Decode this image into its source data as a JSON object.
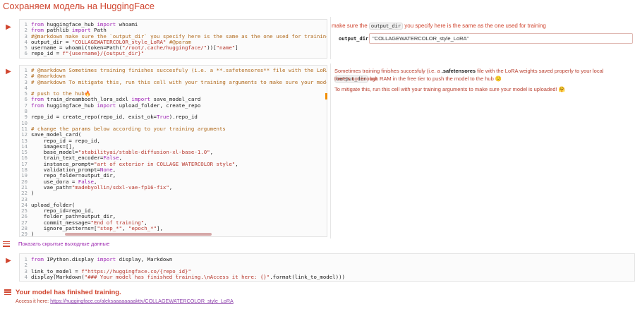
{
  "section": {
    "title": "Сохраняем модель на HuggingFace"
  },
  "cell1": {
    "lines": [
      {
        "n": "1",
        "t": "from huggingface_hub import whoami"
      },
      {
        "n": "2",
        "t": "from pathlib import Path"
      },
      {
        "n": "3",
        "t": "#@markdown make sure the `output_dir` you specify here is the same as the one used for training"
      },
      {
        "n": "4",
        "t": "output_dir = \"COLLAGEWATERCOLOR_style_LoRA\" #@param"
      },
      {
        "n": "5",
        "t": "username = whoami(token=Path(\"/root/.cache/huggingface/\"))[\"name\"]"
      },
      {
        "n": "6",
        "t": "repo_id = f\"{username}/{output_dir}\""
      }
    ],
    "form": {
      "note_pre": "make sure the ",
      "note_code": "output_dir",
      "note_post": " you specify here is the same as the one used for training",
      "field_label": "output_dir:",
      "field_value": "\"COLLAGEWATERCOLOR_style_LoRA\""
    }
  },
  "cell2": {
    "lines": [
      {
        "n": "1",
        "t": "# @markdown Sometimes training finishes succesfuly (i.e. a **.safetensores** file with the LoRA weights saved properly to your l"
      },
      {
        "n": "2",
        "t": "# @markdown"
      },
      {
        "n": "3",
        "t": "# @markdown To mitigate this, run this cell with your training arguments to make sure your model is uploaded! 🤗"
      },
      {
        "n": "4",
        "t": ""
      },
      {
        "n": "5",
        "t": "# push to the hub🔥"
      },
      {
        "n": "6",
        "t": "from train_dreambooth_lora_sdxl import save_model_card"
      },
      {
        "n": "7",
        "t": "from huggingface_hub import upload_folder, create_repo"
      },
      {
        "n": "8",
        "t": ""
      },
      {
        "n": "9",
        "t": "repo_id = create_repo(repo_id, exist_ok=True).repo_id"
      },
      {
        "n": "10",
        "t": ""
      },
      {
        "n": "11",
        "t": "# change the params below according to your training arguments"
      },
      {
        "n": "12",
        "t": "save_model_card("
      },
      {
        "n": "13",
        "t": "    repo_id = repo_id,"
      },
      {
        "n": "14",
        "t": "    images=[],"
      },
      {
        "n": "15",
        "t": "    base_model=\"stabilityai/stable-diffusion-xl-base-1.0\","
      },
      {
        "n": "16",
        "t": "    train_text_encoder=False,"
      },
      {
        "n": "17",
        "t": "    instance_prompt=\"art of exterior in COLLAGE WATERCOLOR style\","
      },
      {
        "n": "18",
        "t": "    validation_prompt=None,"
      },
      {
        "n": "19",
        "t": "    repo_folder=output_dir,"
      },
      {
        "n": "20",
        "t": "    use_dora = False,"
      },
      {
        "n": "21",
        "t": "    vae_path=\"madebyollin/sdxl-vae-fp16-fix\","
      },
      {
        "n": "22",
        "t": ")"
      },
      {
        "n": "23",
        "t": ""
      },
      {
        "n": "24",
        "t": "upload_folder("
      },
      {
        "n": "25",
        "t": "    repo_id=repo_id,"
      },
      {
        "n": "26",
        "t": "    folder_path=output_dir,"
      },
      {
        "n": "27",
        "t": "    commit_message=\"End of training\","
      },
      {
        "n": "28",
        "t": "    ignore_patterns=[\"step_*\", \"epoch_*\"],"
      },
      {
        "n": "29",
        "t": ")"
      }
    ],
    "md_line1_pre": "Sometimes training finishes succesfuly (i.e. a ",
    "md_line1_bold": ".safetensores",
    "md_line1_post": " file with the LoRA weights saved properly to your local ",
    "md_line1_code": "output_dir",
    "md_line1_end": " but",
    "md_line2": "there's not enough RAM in the free tier to push the model to the hub 🙁",
    "md_line3": "To mitigate this, run this cell with your training arguments to make sure your model is uploaded! 🤗"
  },
  "toggle": {
    "label": "Показать скрытые выходные данные"
  },
  "cell3": {
    "lines": [
      {
        "n": "1",
        "t": "from IPython.display import display, Markdown"
      },
      {
        "n": "2",
        "t": ""
      },
      {
        "n": "3",
        "t": "link_to_model = f\"https://huggingface.co/{repo_id}\""
      },
      {
        "n": "4",
        "t": "display(Markdown(\"### Your model has finished training.\\nAccess it here: {}\".format(link_to_model)))"
      }
    ]
  },
  "output": {
    "title": "Your model has finished training.",
    "access_label": "Access it here: ",
    "link_text": "https://huggingface.co/aleksaaaaaaaakttv/COLLAGEWATERCOLOR_style_LoRA"
  },
  "colors": {
    "accent": "#d0452f",
    "link": "#8e44ad",
    "marker": "#f08c00"
  }
}
